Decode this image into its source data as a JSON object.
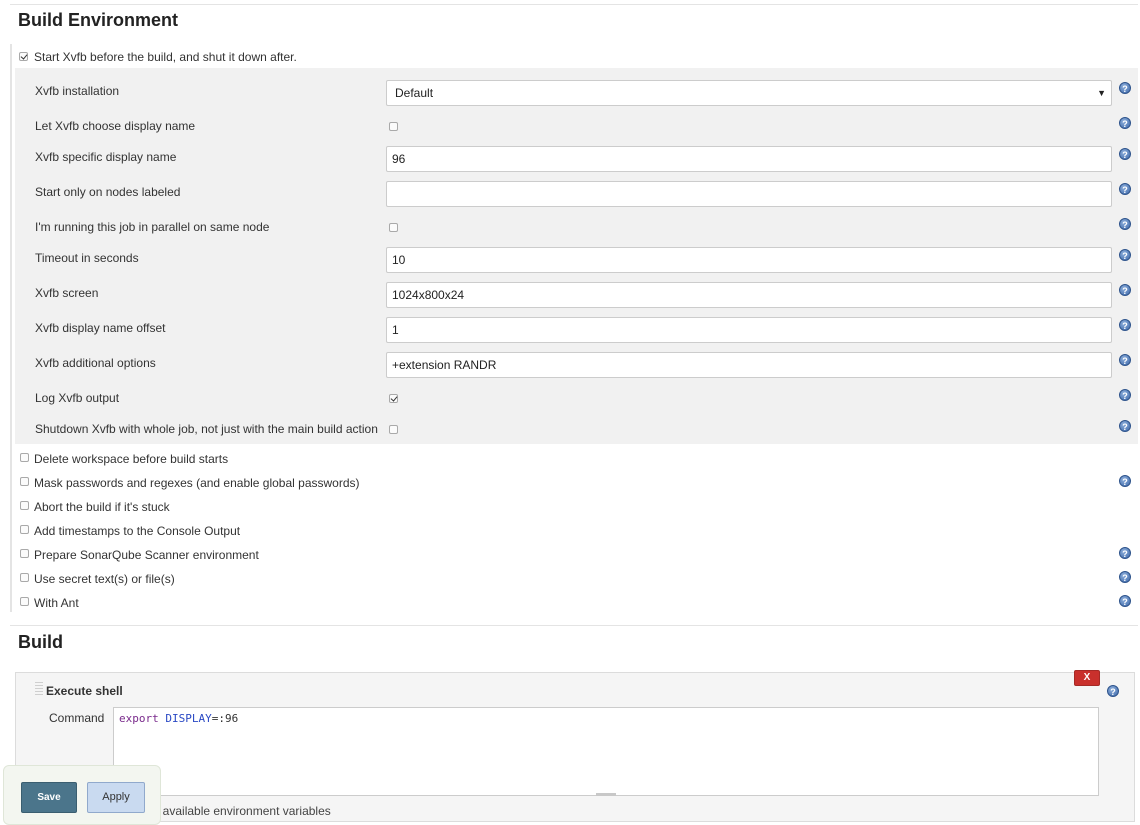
{
  "build_env": {
    "title": "Build Environment",
    "xvfb_toggle_label": "Start Xvfb before the build, and shut it down after.",
    "rows": {
      "installation_label": "Xvfb installation",
      "installation_value": "Default",
      "choose_display_label": "Let Xvfb choose display name",
      "display_name_label": "Xvfb specific display name",
      "display_name_value": "96",
      "nodes_label": "Start only on nodes labeled",
      "nodes_value": "",
      "parallel_label": "I'm running this job in parallel on same node",
      "timeout_label": "Timeout in seconds",
      "timeout_value": "10",
      "screen_label": "Xvfb screen",
      "screen_value": "1024x800x24",
      "offset_label": "Xvfb display name offset",
      "offset_value": "1",
      "additional_label": "Xvfb additional options",
      "additional_value": "+extension RANDR",
      "log_label": "Log Xvfb output",
      "shutdown_label": "Shutdown Xvfb with whole job, not just with the main build action"
    },
    "options": {
      "delete_ws": "Delete workspace before build starts",
      "mask_pw": "Mask passwords and regexes (and enable global passwords)",
      "abort_stuck": "Abort the build if it's stuck",
      "timestamps": "Add timestamps to the Console Output",
      "sonarqube": "Prepare SonarQube Scanner environment",
      "secret": "Use secret text(s) or file(s)",
      "ant": "With Ant"
    }
  },
  "build": {
    "title": "Build",
    "step_title": "Execute shell",
    "delete_label": "X",
    "command_label": "Command",
    "command_keyword": "export",
    "command_var": "DISPLAY",
    "command_value": "=:96",
    "hint": "…ist of available environment variables"
  },
  "footer": {
    "save_label": "Save",
    "apply_label": "Apply"
  },
  "colors": {
    "save_bg": "#4b758b",
    "apply_bg": "#c9daf0",
    "help_icon": "#3a66a8",
    "delete_bg": "#c9302c"
  },
  "icons": {
    "help": "help-icon",
    "dropdown": "chevron-down-icon"
  },
  "help_glyph": "?"
}
